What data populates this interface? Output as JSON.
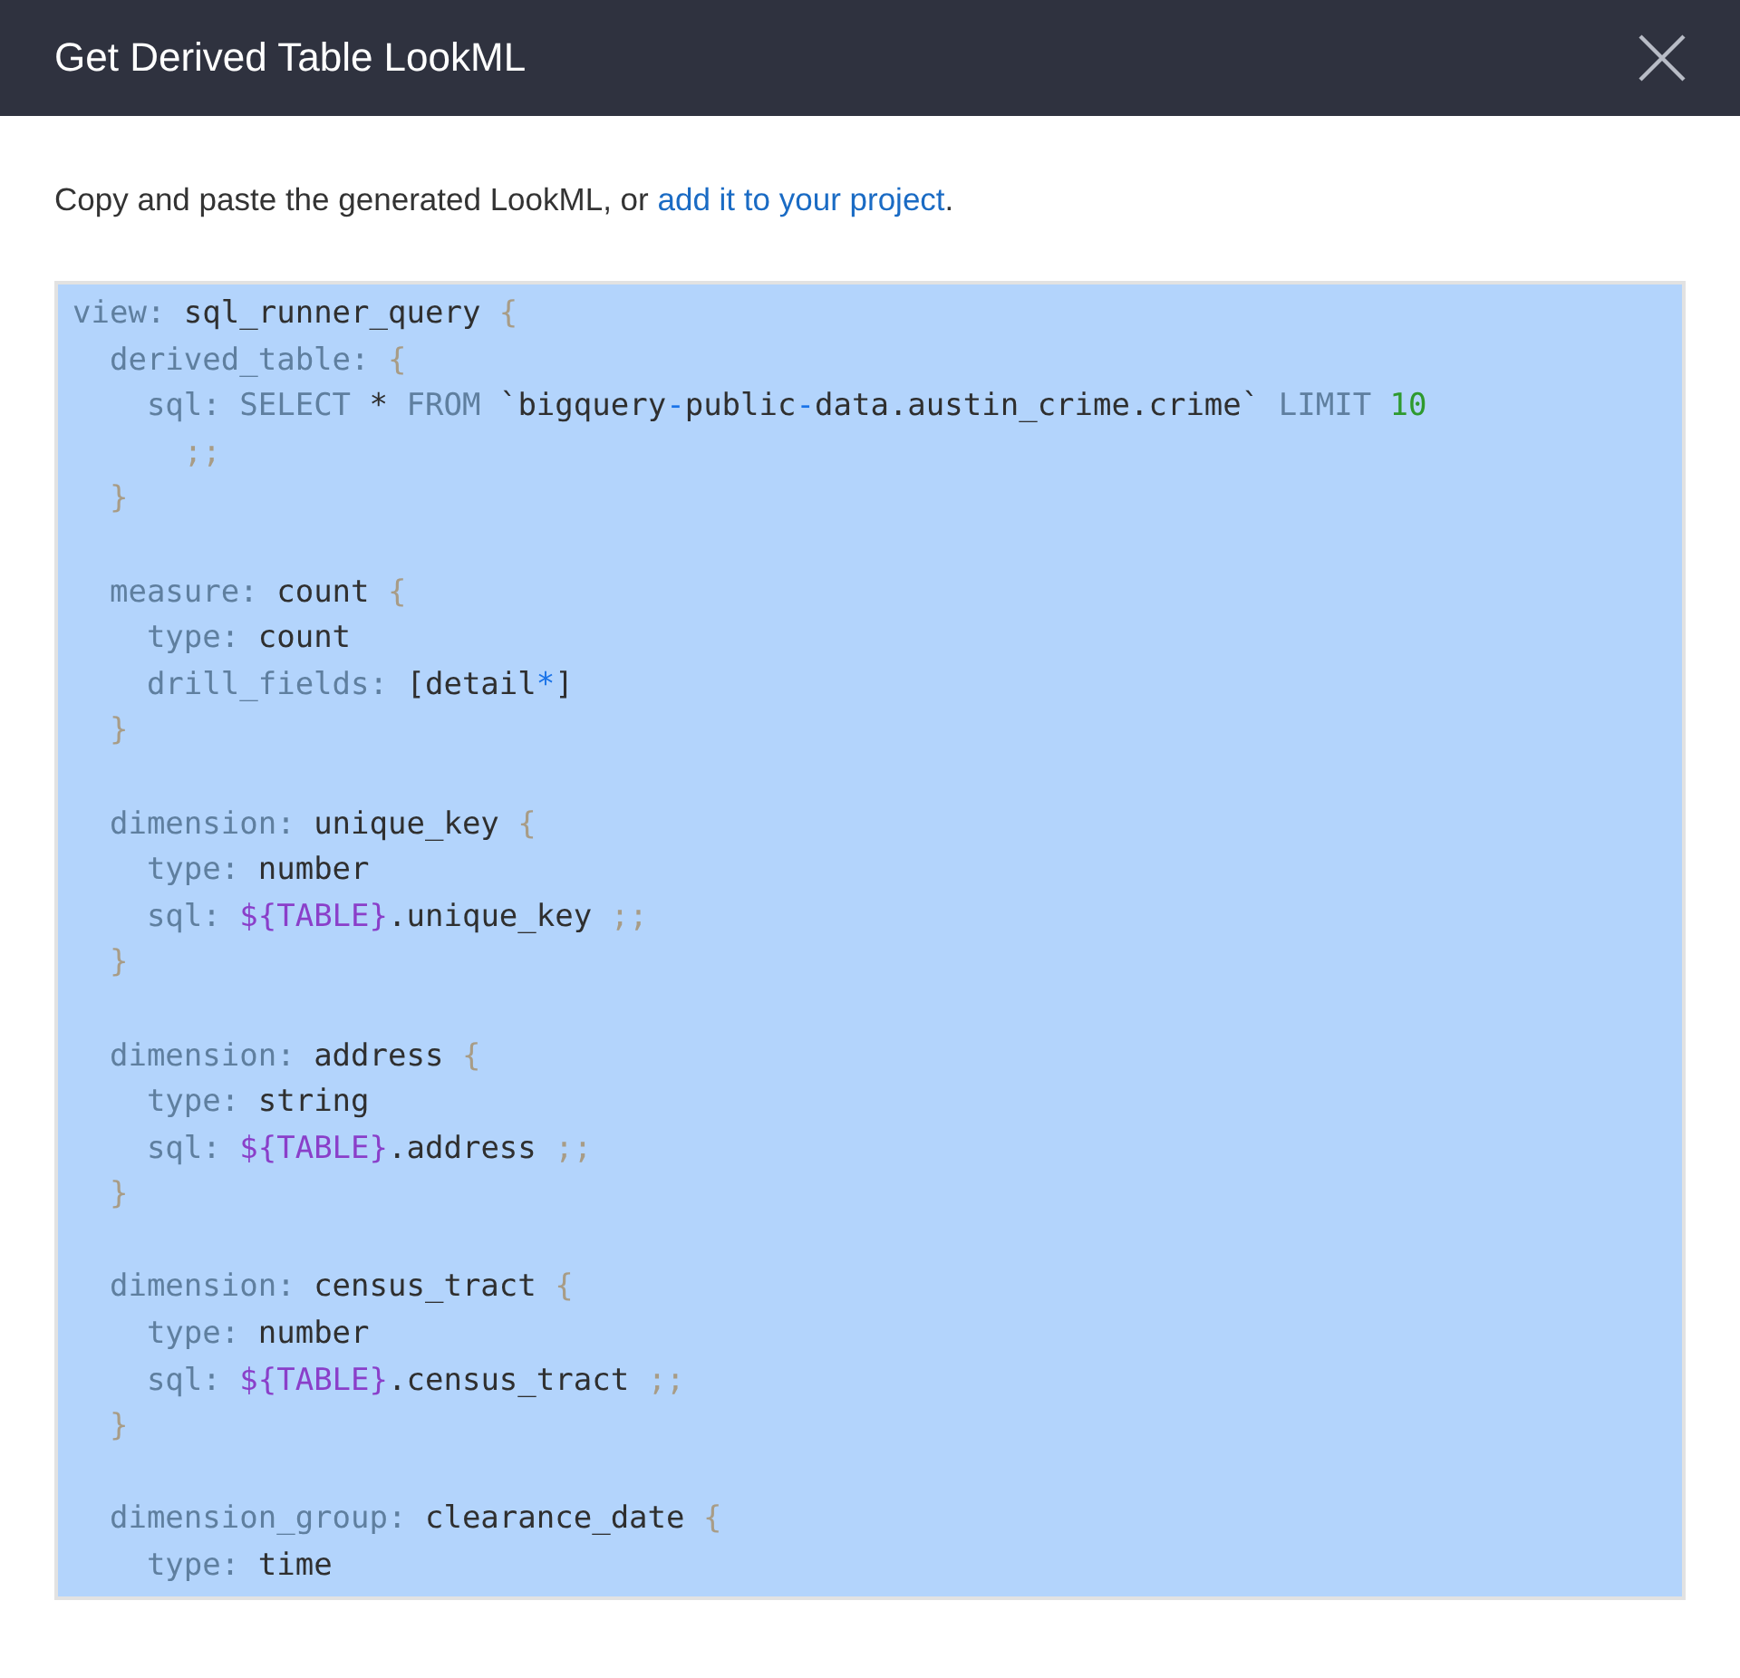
{
  "dialog": {
    "title": "Get Derived Table LookML"
  },
  "intro": {
    "text": "Copy and paste the generated LookML, or ",
    "link": "add it to your project",
    "after": "."
  },
  "code": {
    "blocks": [
      {
        "lines": [
          [
            {
              "kind": "key",
              "text": "view:"
            },
            {
              "kind": "name",
              "text": " sql_runner_query "
            },
            {
              "kind": "punct",
              "text": "{"
            }
          ],
          [
            {
              "kind": "key",
              "text": "  derived_table:"
            },
            {
              "kind": "punct",
              "text": " {"
            }
          ],
          [
            {
              "kind": "key",
              "text": "    sql:"
            },
            {
              "kind": "kw",
              "text": " SELECT "
            },
            {
              "kind": "name",
              "text": "* "
            },
            {
              "kind": "kw",
              "text": "FROM "
            },
            {
              "kind": "name",
              "text": "`bigquery"
            },
            {
              "kind": "dash",
              "text": "-"
            },
            {
              "kind": "name",
              "text": "public"
            },
            {
              "kind": "dash",
              "text": "-"
            },
            {
              "kind": "name",
              "text": "data.austin_crime.crime` "
            },
            {
              "kind": "kw",
              "text": "LIMIT "
            },
            {
              "kind": "num",
              "text": "10"
            }
          ],
          [
            {
              "kind": "punct",
              "text": "      ;;"
            }
          ],
          [
            {
              "kind": "punct",
              "text": "  }"
            }
          ]
        ]
      },
      {
        "lines": [
          [
            {
              "kind": "key",
              "text": "  measure:"
            },
            {
              "kind": "name",
              "text": " count "
            },
            {
              "kind": "punct",
              "text": "{"
            }
          ],
          [
            {
              "kind": "key",
              "text": "    type:"
            },
            {
              "kind": "name",
              "text": " count"
            }
          ],
          [
            {
              "kind": "key",
              "text": "    drill_fields:"
            },
            {
              "kind": "name",
              "text": " [detail"
            },
            {
              "kind": "dash",
              "text": "*"
            },
            {
              "kind": "name",
              "text": "]"
            }
          ],
          [
            {
              "kind": "punct",
              "text": "  }"
            }
          ]
        ]
      },
      {
        "lines": [
          [
            {
              "kind": "key",
              "text": "  dimension:"
            },
            {
              "kind": "name",
              "text": " unique_key "
            },
            {
              "kind": "punct",
              "text": "{"
            }
          ],
          [
            {
              "kind": "key",
              "text": "    type:"
            },
            {
              "kind": "name",
              "text": " number"
            }
          ],
          [
            {
              "kind": "key",
              "text": "    sql:"
            },
            {
              "kind": "tmpl",
              "text": " ${TABLE}"
            },
            {
              "kind": "name",
              "text": ".unique_key "
            },
            {
              "kind": "punct",
              "text": ";;"
            }
          ],
          [
            {
              "kind": "punct",
              "text": "  }"
            }
          ]
        ]
      },
      {
        "lines": [
          [
            {
              "kind": "key",
              "text": "  dimension:"
            },
            {
              "kind": "name",
              "text": " address "
            },
            {
              "kind": "punct",
              "text": "{"
            }
          ],
          [
            {
              "kind": "key",
              "text": "    type:"
            },
            {
              "kind": "name",
              "text": " string"
            }
          ],
          [
            {
              "kind": "key",
              "text": "    sql:"
            },
            {
              "kind": "tmpl",
              "text": " ${TABLE}"
            },
            {
              "kind": "name",
              "text": ".address "
            },
            {
              "kind": "punct",
              "text": ";;"
            }
          ],
          [
            {
              "kind": "punct",
              "text": "  }"
            }
          ]
        ]
      },
      {
        "lines": [
          [
            {
              "kind": "key",
              "text": "  dimension:"
            },
            {
              "kind": "name",
              "text": " census_tract "
            },
            {
              "kind": "punct",
              "text": "{"
            }
          ],
          [
            {
              "kind": "key",
              "text": "    type:"
            },
            {
              "kind": "name",
              "text": " number"
            }
          ],
          [
            {
              "kind": "key",
              "text": "    sql:"
            },
            {
              "kind": "tmpl",
              "text": " ${TABLE}"
            },
            {
              "kind": "name",
              "text": ".census_tract "
            },
            {
              "kind": "punct",
              "text": ";;"
            }
          ],
          [
            {
              "kind": "punct",
              "text": "  }"
            }
          ]
        ]
      },
      {
        "lines": [
          [
            {
              "kind": "key",
              "text": "  dimension_group:"
            },
            {
              "kind": "name",
              "text": " clearance_date "
            },
            {
              "kind": "punct",
              "text": "{"
            }
          ],
          [
            {
              "kind": "key",
              "text": "    type:"
            },
            {
              "kind": "name",
              "text": " time"
            }
          ]
        ]
      }
    ]
  }
}
